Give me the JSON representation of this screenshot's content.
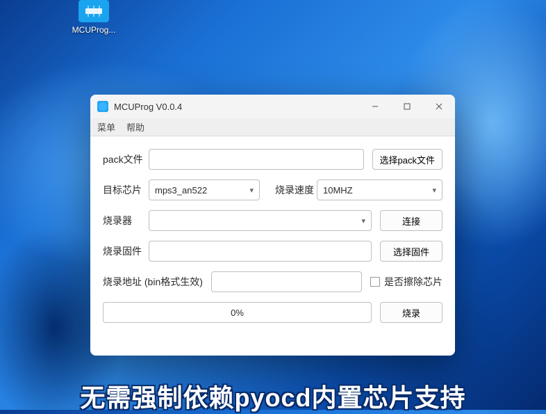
{
  "desktop": {
    "icon_label": "MCUProg..."
  },
  "window": {
    "title": "MCUProg V0.0.4",
    "menu": {
      "menu1": "菜单",
      "menu2": "帮助"
    },
    "labels": {
      "pack_file": "pack文件",
      "target_chip": "目标芯片",
      "burn_speed": "烧录速度",
      "programmer": "烧录器",
      "firmware": "烧录固件",
      "burn_addr": "烧录地址 (bin格式生效)",
      "erase_chip": "是否擦除芯片"
    },
    "values": {
      "pack_file": "",
      "target_chip": "mps3_an522",
      "burn_speed": "10MHZ",
      "programmer": "",
      "firmware": "",
      "burn_addr": "",
      "progress": "0%"
    },
    "buttons": {
      "select_pack": "选择pack文件",
      "connect": "连接",
      "select_fw": "选择固件",
      "burn": "烧录"
    }
  },
  "caption": "无需强制依赖pyocd内置芯片支持"
}
